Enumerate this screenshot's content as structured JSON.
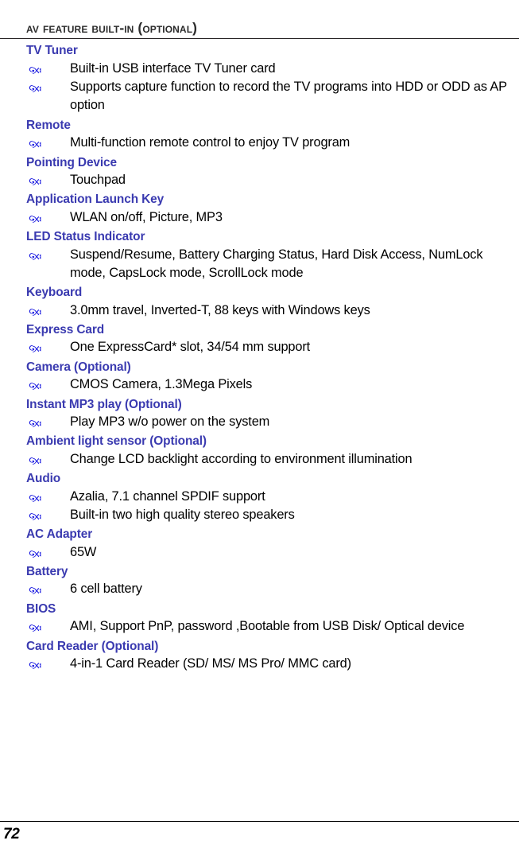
{
  "document": {
    "title": "AV Feature Built-in (Optional)",
    "heading_color": "#3a3ab0",
    "title_color": "#2b2b2b",
    "bullet_color": "#1a1ae0",
    "bullet_icon": "swirl-flourish-bullet"
  },
  "sections": [
    {
      "heading": "TV Tuner",
      "bullets": [
        "Built-in USB interface TV Tuner card",
        "Supports capture function to record the TV programs into HDD or ODD as AP option"
      ]
    },
    {
      "heading": "Remote",
      "bullets": [
        "Multi-function remote control to enjoy TV program"
      ]
    },
    {
      "heading": "Pointing Device",
      "bullets": [
        "Touchpad"
      ]
    },
    {
      "heading": "Application Launch Key",
      "bullets": [
        "WLAN on/off, Picture, MP3"
      ]
    },
    {
      "heading": "LED Status Indicator",
      "bullets": [
        "Suspend/Resume, Battery Charging Status, Hard Disk Access, NumLock mode, CapsLock mode, ScrollLock mode"
      ]
    },
    {
      "heading": "Keyboard",
      "bullets": [
        "3.0mm travel, Inverted-T, 88 keys with Windows keys"
      ]
    },
    {
      "heading": "Express Card",
      "bullets": [
        "One ExpressCard* slot, 34/54 mm support"
      ]
    },
    {
      "heading": "Camera (Optional)",
      "bullets": [
        "CMOS Camera, 1.3Mega Pixels"
      ]
    },
    {
      "heading": "Instant MP3 play (Optional)",
      "bullets": [
        "Play MP3 w/o power on the system"
      ]
    },
    {
      "heading": "Ambient light sensor (Optional)",
      "bullets": [
        "Change LCD backlight according to environment illumination"
      ]
    },
    {
      "heading": "Audio",
      "bullets": [
        "Azalia, 7.1 channel SPDIF support",
        "Built-in two high quality stereo speakers"
      ]
    },
    {
      "heading": "AC Adapter",
      "bullets": [
        "65W"
      ]
    },
    {
      "heading": "Battery",
      "bullets": [
        "6 cell battery"
      ]
    },
    {
      "heading": "BIOS",
      "bullets": [
        "AMI, Support PnP, password ,Bootable from USB Disk/ Optical device"
      ]
    },
    {
      "heading": "Card Reader (Optional)",
      "bullets": [
        "4-in-1 Card Reader (SD/ MS/ MS Pro/ MMC card)"
      ]
    }
  ],
  "footer": {
    "page_number": "72"
  }
}
